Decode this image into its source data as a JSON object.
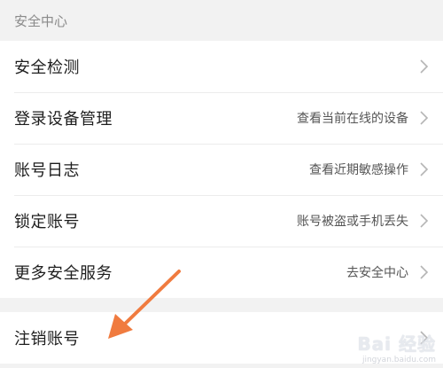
{
  "section": {
    "title": "安全中心"
  },
  "items": [
    {
      "label": "安全检测",
      "hint": ""
    },
    {
      "label": "登录设备管理",
      "hint": "查看当前在线的设备"
    },
    {
      "label": "账号日志",
      "hint": "查看近期敏感操作"
    },
    {
      "label": "锁定账号",
      "hint": "账号被盗或手机丢失"
    },
    {
      "label": "更多安全服务",
      "hint": "去安全中心"
    }
  ],
  "cancel": {
    "label": "注销账号"
  },
  "watermark": {
    "main": "Bai 经验",
    "sub": "jingyan.baidu.com"
  },
  "colors": {
    "arrow": "#f07b3f",
    "background": "#f2f2f2",
    "card": "#ffffff"
  }
}
